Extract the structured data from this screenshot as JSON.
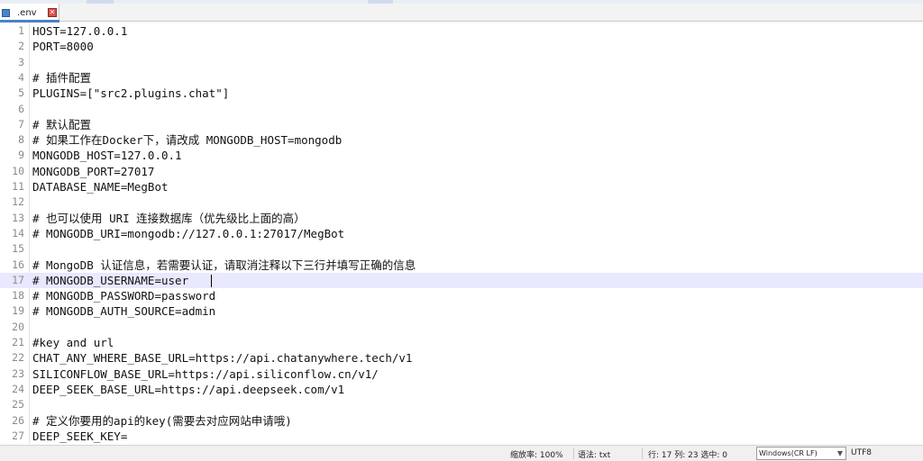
{
  "tab": {
    "label": ".env",
    "icon": "document-icon",
    "close_icon": "close-icon",
    "close_glyph": "✕"
  },
  "editor": {
    "lines": [
      {
        "n": "1",
        "text": "HOST=127.0.0.1"
      },
      {
        "n": "2",
        "text": "PORT=8000"
      },
      {
        "n": "3",
        "text": ""
      },
      {
        "n": "4",
        "text": "# 插件配置"
      },
      {
        "n": "5",
        "text": "PLUGINS=[\"src2.plugins.chat\"]"
      },
      {
        "n": "6",
        "text": ""
      },
      {
        "n": "7",
        "text": "# 默认配置"
      },
      {
        "n": "8",
        "text": "# 如果工作在Docker下，请改成 MONGODB_HOST=mongodb"
      },
      {
        "n": "9",
        "text": "MONGODB_HOST=127.0.0.1"
      },
      {
        "n": "10",
        "text": "MONGODB_PORT=27017"
      },
      {
        "n": "11",
        "text": "DATABASE_NAME=MegBot"
      },
      {
        "n": "12",
        "text": ""
      },
      {
        "n": "13",
        "text": "# 也可以使用 URI 连接数据库（优先级比上面的高）"
      },
      {
        "n": "14",
        "text": "# MONGODB_URI=mongodb://127.0.0.1:27017/MegBot"
      },
      {
        "n": "15",
        "text": ""
      },
      {
        "n": "16",
        "text": "# MongoDB 认证信息，若需要认证，请取消注释以下三行并填写正确的信息"
      },
      {
        "n": "17",
        "text": "# MONGODB_USERNAME=user"
      },
      {
        "n": "18",
        "text": "# MONGODB_PASSWORD=password"
      },
      {
        "n": "19",
        "text": "# MONGODB_AUTH_SOURCE=admin"
      },
      {
        "n": "20",
        "text": ""
      },
      {
        "n": "21",
        "text": "#key and url"
      },
      {
        "n": "22",
        "text": "CHAT_ANY_WHERE_BASE_URL=https://api.chatanywhere.tech/v1"
      },
      {
        "n": "23",
        "text": "SILICONFLOW_BASE_URL=https://api.siliconflow.cn/v1/"
      },
      {
        "n": "24",
        "text": "DEEP_SEEK_BASE_URL=https://api.deepseek.com/v1"
      },
      {
        "n": "25",
        "text": ""
      },
      {
        "n": "26",
        "text": "# 定义你要用的api的key(需要去对应网站申请哦)"
      },
      {
        "n": "27",
        "text": "DEEP_SEEK_KEY="
      }
    ],
    "active_line": 17,
    "colors": {
      "active_line_bg": "#e8e8ff",
      "line_number": "#8a8a8a"
    }
  },
  "status": {
    "zoom": "缩放率: 100%",
    "syntax": "语法: txt",
    "position": "行: 17  列: 23  选中: 0",
    "line_ending": "Windows(CR LF)",
    "encoding": "UTF8"
  }
}
